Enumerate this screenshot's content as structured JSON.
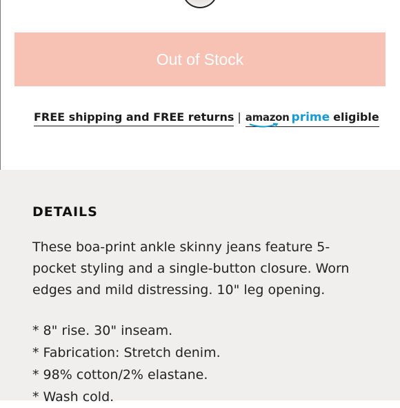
{
  "product": {
    "stock_button_label": "Out of Stock"
  },
  "shipping": {
    "free_shipping_text": "FREE shipping and FREE returns",
    "separator": "|",
    "amazon_text": "amazon",
    "prime_text": "prime",
    "eligible_text": "eligible"
  },
  "details": {
    "heading": "DETAILS",
    "description": "These boa-print ankle skinny jeans feature 5-pocket styling and a single-button closure. Worn edges and mild distressing. 10\" leg opening.",
    "specs": [
      "* 8\" rise. 30\" inseam.",
      "* Fabrication: Stretch denim.",
      "* 98% cotton/2% elastane.",
      "* Wash cold."
    ]
  },
  "colors": {
    "button_bg": "#f7c2b4",
    "prime_blue": "#1a98d0",
    "details_bg": "#f1efee"
  }
}
